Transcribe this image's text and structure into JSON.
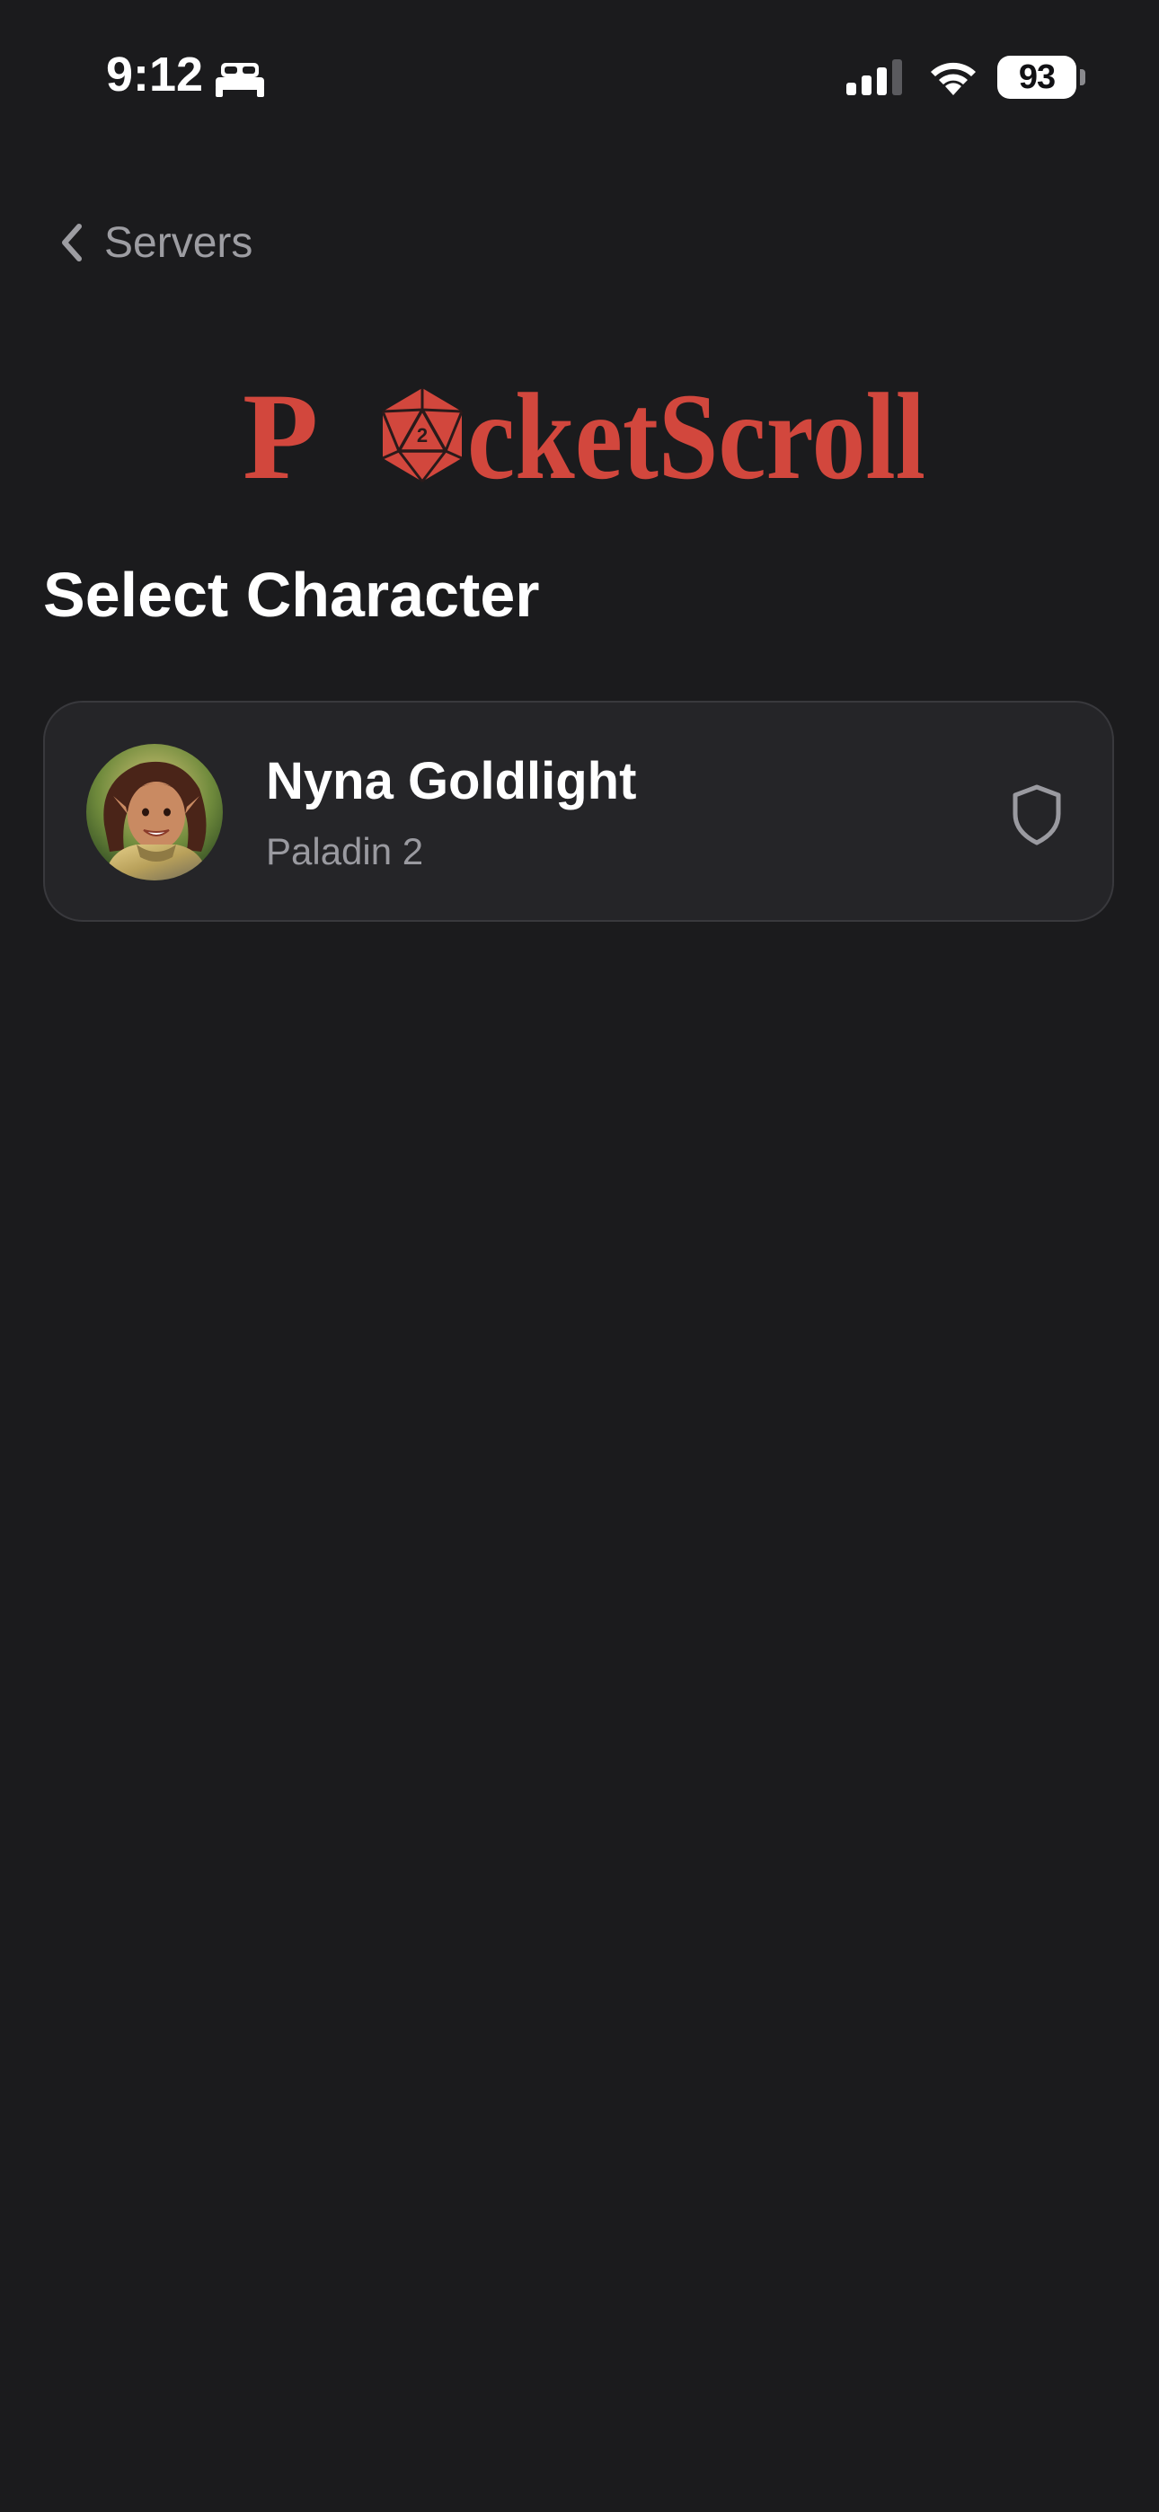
{
  "status_bar": {
    "time": "9:12",
    "focus_icon": "bed-icon",
    "battery_level": "93"
  },
  "nav": {
    "back_label": "Servers"
  },
  "logo": {
    "text_start": "P",
    "text_end": "cketScroll",
    "die_number": "2",
    "color": "#d2473d"
  },
  "title": "Select Character",
  "characters": [
    {
      "name": "Nyna Goldlight",
      "class_level": "Paladin 2",
      "icon": "shield-icon"
    }
  ],
  "colors": {
    "background": "#1b1b1d",
    "card": "#252528",
    "card_border": "#39393d",
    "secondary_text": "#9a9aa0",
    "brand": "#d2473d"
  }
}
